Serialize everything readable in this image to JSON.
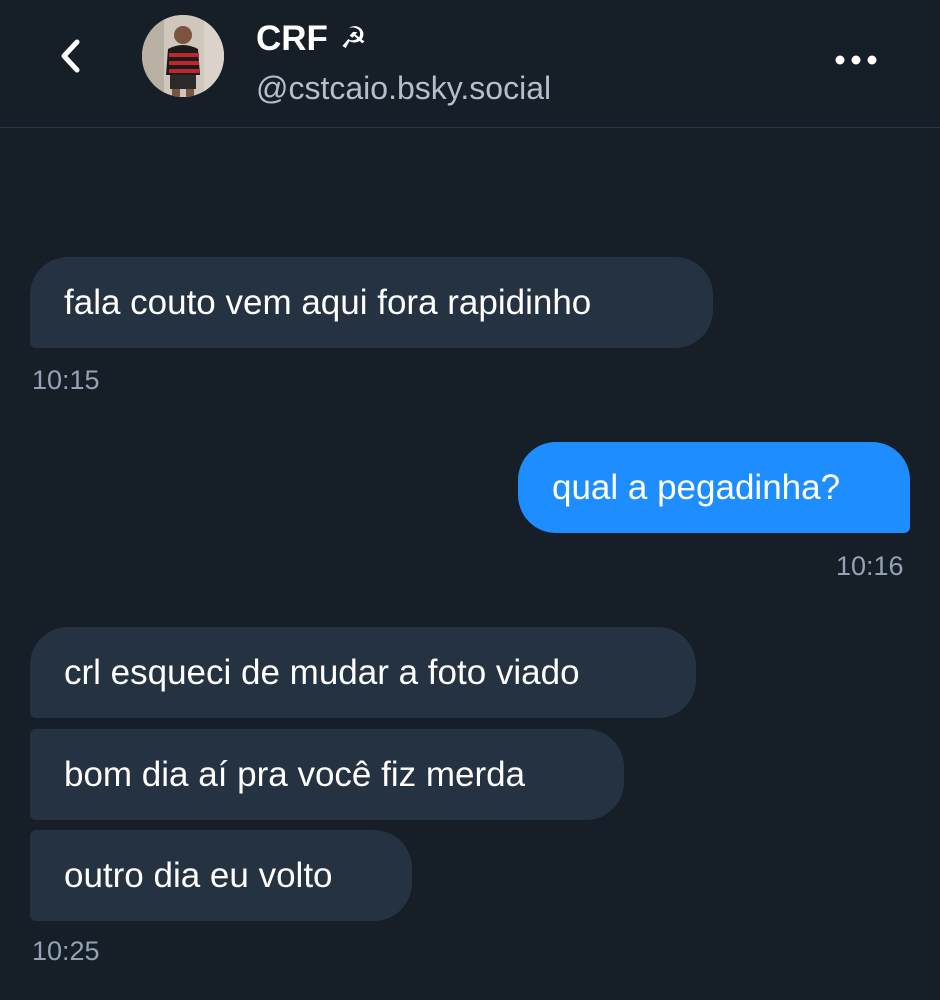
{
  "header": {
    "back_icon": "chevron-left-icon",
    "title": "CRF",
    "title_emoji": "☭",
    "handle": "@cstcaio.bsky.social",
    "more_icon": "more-horizontal-icon"
  },
  "messages": [
    {
      "direction": "incoming",
      "text": "fala couto vem aqui fora rapidinho"
    },
    {
      "direction": "outgoing",
      "text": "qual a pegadinha?"
    },
    {
      "direction": "incoming",
      "text": "crl esqueci de mudar a foto viado"
    },
    {
      "direction": "incoming",
      "text": "bom dia aí pra você fiz merda"
    },
    {
      "direction": "incoming",
      "text": "outro dia eu volto"
    }
  ],
  "timestamps": [
    "10:15",
    "10:16",
    "10:25"
  ],
  "colors": {
    "background": "#161e27",
    "incoming_bubble": "#253242",
    "outgoing_bubble": "#1d8dff",
    "timestamp": "#93a3b5",
    "handle": "#b3bfcc"
  }
}
